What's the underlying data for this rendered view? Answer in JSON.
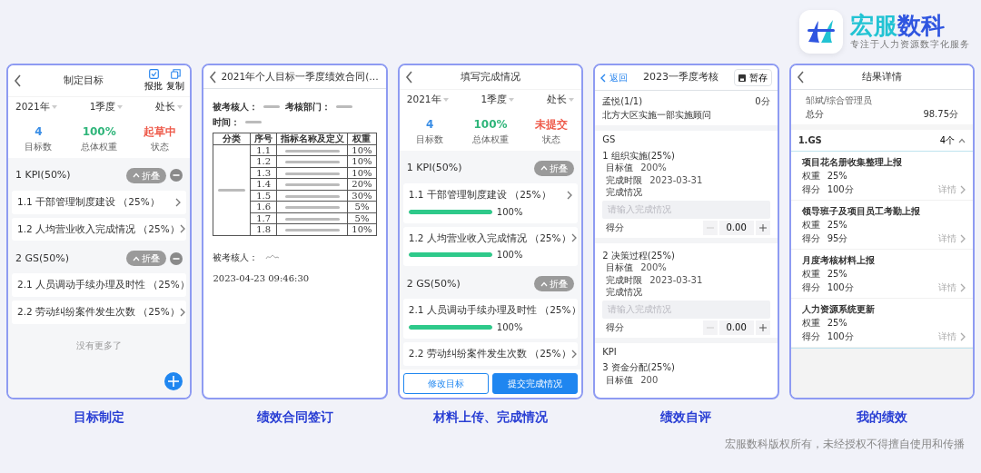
{
  "brand": {
    "name_parts": [
      {
        "text": "宏服",
        "color": "#22c3d3"
      },
      {
        "text": "数科",
        "color": "#2f55e0"
      }
    ],
    "tagline": "专注于人力资源数字化服务"
  },
  "goal_setting": {
    "title": "制定目标",
    "actions": [
      {
        "label": "报批"
      },
      {
        "label": "复制"
      }
    ],
    "filters": [
      "2021年",
      "1季度",
      "处长"
    ],
    "stats": [
      {
        "value": "4",
        "label": "目标数",
        "color": "#3a8ee6"
      },
      {
        "value": "100%",
        "label": "总体权重",
        "color": "#2fb57a"
      },
      {
        "value": "起草中",
        "label": "状态",
        "color": "#ee5b4b"
      }
    ],
    "groups": [
      {
        "title": "1 KPI(50%)",
        "collapse_label": "折叠",
        "expanded": true,
        "items": [
          {
            "label": "1.1 干部管理制度建设 （25%）"
          },
          {
            "label": "1.2 人均营业收入完成情况 （25%）"
          }
        ]
      },
      {
        "title": "2 GS(50%)",
        "collapse_label": "折叠",
        "expanded": true,
        "items": [
          {
            "label": "2.1 人员调动手续办理及时性 （25%）"
          },
          {
            "label": "2.2 劳动纠纷案件发生次数 （25%）"
          }
        ]
      }
    ],
    "footer_note": "没有更多了"
  },
  "contract": {
    "title": "2021年个人目标一季度绩效合同(…",
    "document": {
      "header_labels": [
        "被考核人：",
        "考核部门：",
        "时间："
      ],
      "columns": [
        "分类",
        "序号",
        "指标名称及定义",
        "权重"
      ],
      "rows": [
        {
          "seq": "1.1",
          "weight": "10%"
        },
        {
          "seq": "1.2",
          "weight": "10%"
        },
        {
          "seq": "1.3",
          "weight": "10%"
        },
        {
          "seq": "1.4",
          "weight": "20%"
        },
        {
          "seq": "1.5",
          "weight": "30%"
        },
        {
          "seq": "1.6",
          "weight": "5%"
        },
        {
          "seq": "1.7",
          "weight": "5%"
        },
        {
          "seq": "1.8",
          "weight": "10%"
        }
      ],
      "signer_label": "被考核人：",
      "date": "2023-04-23 09:46:30"
    }
  },
  "completion": {
    "title": "填写完成情况",
    "filters": [
      "2021年",
      "1季度",
      "处长"
    ],
    "stats": [
      {
        "value": "4",
        "label": "目标数",
        "color": "#3a8ee6"
      },
      {
        "value": "100%",
        "label": "总体权重",
        "color": "#2fb57a"
      },
      {
        "value": "未提交",
        "label": "状态",
        "color": "#ee5b4b"
      }
    ],
    "groups": [
      {
        "title": "1 KPI(50%)",
        "collapse_label": "折叠",
        "expanded": true,
        "items": [
          {
            "label": "1.1 干部管理制度建设 （25%）",
            "level": 1,
            "reading": "100%"
          },
          {
            "label": "1.2 人均营业收入完成情况 （25%）",
            "level": 1,
            "reading": "100%"
          }
        ]
      },
      {
        "title": "2 GS(50%)",
        "collapse_label": "折叠",
        "expanded": true,
        "items": [
          {
            "label": "2.1 人员调动手续办理及时性 （25%）",
            "level": 1,
            "reading": "100%"
          },
          {
            "label": "2.2 劳动纠纷案件发生次数 （25%）"
          }
        ]
      }
    ],
    "buttons": [
      {
        "label": "修改目标",
        "kind": "outline"
      },
      {
        "label": "提交完成情况",
        "kind": "primary"
      }
    ]
  },
  "self_review": {
    "back": "返回",
    "title": "2023一季度考核",
    "save": "暂存",
    "person": "孟悦(1/1)",
    "score": "0分",
    "position": "北方大区实施一部实施顾问",
    "sections": [
      {
        "title": "GS",
        "items": [
          {
            "title": "1 组织实施(25%)",
            "fields": [
              {
                "label": "目标值",
                "value": "200%"
              },
              {
                "label": "完成时限",
                "value": "2023-03-31"
              }
            ],
            "notes_label": "完成情况",
            "notes_placeholder": "请输入完成情况",
            "score_label": "得分",
            "score_value": "0.00"
          },
          {
            "title": "2 决策过程(25%)",
            "fields": [
              {
                "label": "目标值",
                "value": "200%"
              },
              {
                "label": "完成时限",
                "value": "2023-03-31"
              }
            ],
            "notes_label": "完成情况",
            "notes_placeholder": "请输入完成情况",
            "score_label": "得分",
            "score_value": "0.00"
          }
        ]
      },
      {
        "title": "KPI",
        "items": [
          {
            "title": "3 资金分配(25%)",
            "fields": [
              {
                "label": "目标值",
                "value": "200"
              }
            ]
          }
        ]
      }
    ]
  },
  "results": {
    "title": "结果详情",
    "user": "邹斌/综合管理员",
    "total_label": "总分",
    "total": "98.75分",
    "group": {
      "title": "1.GS",
      "count": "4个",
      "expanded": true,
      "items": [
        {
          "name": "项目花名册收集整理上报",
          "weight_label": "权重",
          "weight": "25%",
          "score_label": "得分",
          "score": "100分",
          "link": "详情"
        },
        {
          "name": "领导班子及项目员工考勤上报",
          "weight_label": "权重",
          "weight": "25%",
          "score_label": "得分",
          "score": "95分",
          "link": "详情"
        },
        {
          "name": "月度考核材料上报",
          "weight_label": "权重",
          "weight": "25%",
          "score_label": "得分",
          "score": "100分",
          "link": "详情"
        },
        {
          "name": "人力资源系统更新",
          "weight_label": "权重",
          "weight": "25%",
          "score_label": "得分",
          "score": "100分",
          "link": "详情"
        }
      ]
    }
  },
  "captions": [
    "目标制定",
    "绩效合同签订",
    "材料上传、完成情况",
    "绩效自评",
    "我的绩效"
  ],
  "copyright": "宏服数科版权所有，未经授权不得擅自使用和传播"
}
